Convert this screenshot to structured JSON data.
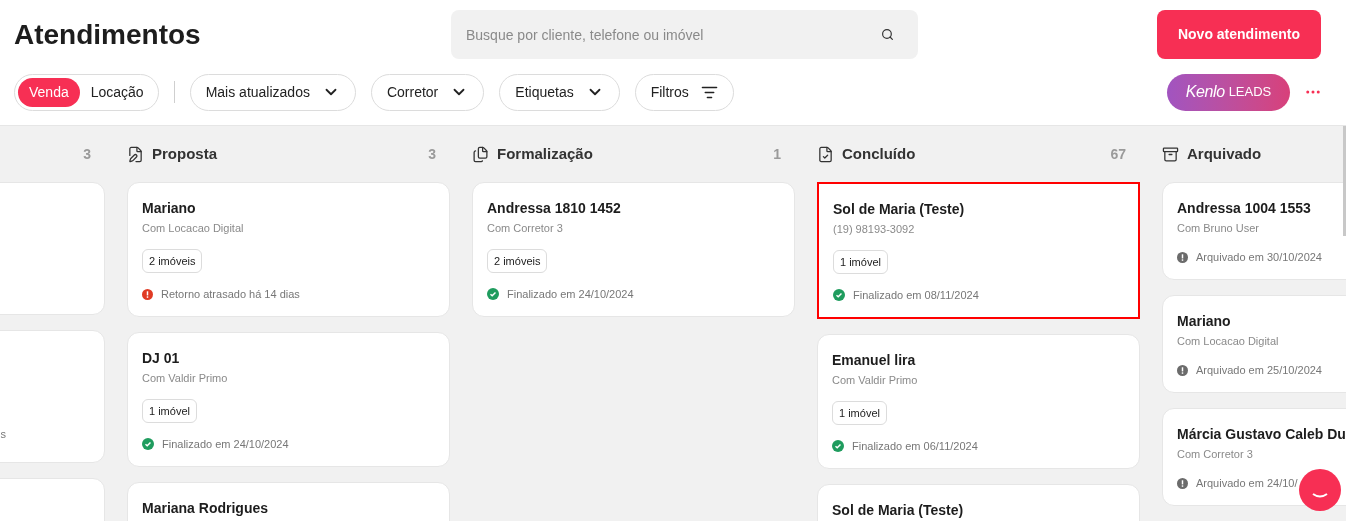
{
  "title": "Atendimentos",
  "search": {
    "placeholder": "Busque por cliente, telefone ou imóvel"
  },
  "new_button": "Novo atendimento",
  "segments": [
    {
      "label": "Venda",
      "selected": true
    },
    {
      "label": "Locação",
      "selected": false
    }
  ],
  "dropdowns": [
    {
      "label": "Mais atualizados",
      "kind": "dropdown"
    },
    {
      "label": "Corretor",
      "kind": "dropdown"
    },
    {
      "label": "Etiquetas",
      "kind": "dropdown"
    },
    {
      "label": "Filtros",
      "kind": "filter"
    }
  ],
  "leads_button": {
    "brand": "Kenlo",
    "product": "LEADS"
  },
  "columns": [
    {
      "kind": "partial",
      "count": "3",
      "cards": [
        {
          "selected": false
        },
        {
          "selected": false,
          "status": {
            "text": "s"
          }
        },
        {
          "selected": false
        }
      ]
    },
    {
      "kind": "proposal",
      "title": "Proposta",
      "count": "3",
      "cards": [
        {
          "selected": false,
          "name": "Mariano",
          "sub": "Com Locacao Digital",
          "tag": "2 imóveis",
          "status": {
            "kind": "late",
            "text": "Retorno atrasado há 14 dias"
          }
        },
        {
          "selected": false,
          "name": "DJ 01",
          "sub": "Com Valdir Primo",
          "tag": "1 imóvel",
          "status": {
            "kind": "done",
            "text": "Finalizado em 24/10/2024"
          }
        },
        {
          "selected": false,
          "name": "Mariana Rodrigues"
        }
      ]
    },
    {
      "kind": "formal",
      "title": "Formalização",
      "count": "1",
      "cards": [
        {
          "selected": false,
          "name": "Andressa 1810 1452",
          "sub": "Com Corretor 3",
          "tag": "2 imóveis",
          "status": {
            "kind": "done",
            "text": "Finalizado em 24/10/2024"
          }
        }
      ]
    },
    {
      "kind": "done",
      "title": "Concluído",
      "count": "67",
      "cards": [
        {
          "selected": true,
          "name": "Sol de Maria (Teste)",
          "sub": "(19) 98193-3092",
          "tag": "1 imóvel",
          "status": {
            "kind": "done",
            "text": "Finalizado em 08/11/2024"
          }
        },
        {
          "selected": false,
          "name": "Emanuel lira",
          "sub": "Com Valdir Primo",
          "tag": "1 imóvel",
          "status": {
            "kind": "done",
            "text": "Finalizado em 06/11/2024"
          }
        },
        {
          "selected": false,
          "name": "Sol de Maria (Teste)"
        }
      ]
    },
    {
      "kind": "archived",
      "title": "Arquivado",
      "cards": [
        {
          "selected": false,
          "name": "Andressa 1004 1553",
          "sub": "Com Bruno User",
          "status": {
            "kind": "archived",
            "text": "Arquivado em 30/10/2024"
          }
        },
        {
          "selected": false,
          "name": "Mariano",
          "sub": "Com Locacao Digital",
          "status": {
            "kind": "archived",
            "text": "Arquivado em 25/10/2024"
          }
        },
        {
          "selected": false,
          "name": "Márcia Gustavo Caleb Du",
          "sub": "Com Corretor 3",
          "status": {
            "kind": "archived",
            "text": "Arquivado em 24/10/"
          }
        }
      ]
    }
  ]
}
